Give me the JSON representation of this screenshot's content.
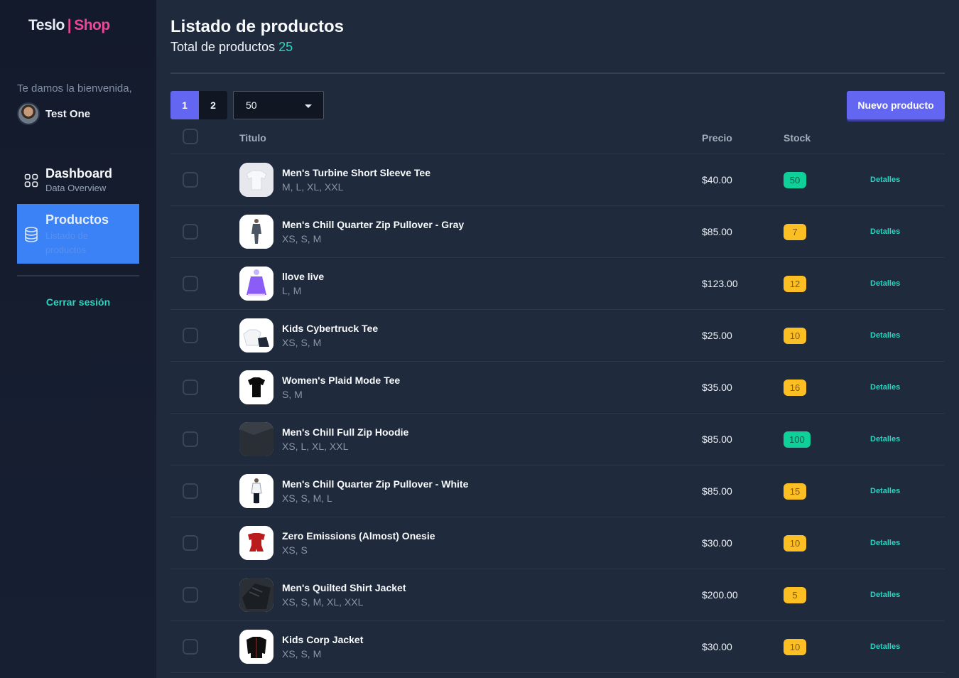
{
  "brand": {
    "name_a": "Teslo",
    "separator": "|",
    "name_b": "Shop"
  },
  "sidebar": {
    "welcome": "Te damos la bienvenida,",
    "user_name": "Test One",
    "items": [
      {
        "title": "Dashboard",
        "subtitle": "Data Overview",
        "icon": "grid-icon"
      },
      {
        "title": "Productos",
        "subtitle": "Listado de productos",
        "icon": "database-icon",
        "active": true
      }
    ],
    "logout": "Cerrar sesión"
  },
  "header": {
    "title": "Listado de productos",
    "subtitle_label": "Total de productos",
    "total": "25"
  },
  "toolbar": {
    "pages": [
      "1",
      "2"
    ],
    "current_page": "1",
    "page_size": "50",
    "new_button": "Nuevo producto"
  },
  "table": {
    "columns": {
      "title": "Titulo",
      "price": "Precio",
      "stock": "Stock"
    },
    "action_label": "Detalles",
    "rows": [
      {
        "name": "Men's Turbine Short Sleeve Tee",
        "sizes": "M, L, XL, XXL",
        "price": "$40.00",
        "stock": "50",
        "status": "ok"
      },
      {
        "name": "Men's Chill Quarter Zip Pullover - Gray",
        "sizes": "XS, S, M",
        "price": "$85.00",
        "stock": "7",
        "status": "low"
      },
      {
        "name": "llove live",
        "sizes": "L, M",
        "price": "$123.00",
        "stock": "12",
        "status": "low"
      },
      {
        "name": "Kids Cybertruck Tee",
        "sizes": "XS, S, M",
        "price": "$25.00",
        "stock": "10",
        "status": "low"
      },
      {
        "name": "Women's Plaid Mode Tee",
        "sizes": "S, M",
        "price": "$35.00",
        "stock": "16",
        "status": "low"
      },
      {
        "name": "Men's Chill Full Zip Hoodie",
        "sizes": "XS, L, XL, XXL",
        "price": "$85.00",
        "stock": "100",
        "status": "ok"
      },
      {
        "name": "Men's Chill Quarter Zip Pullover - White",
        "sizes": "XS, S, M, L",
        "price": "$85.00",
        "stock": "15",
        "status": "low"
      },
      {
        "name": "Zero Emissions (Almost) Onesie",
        "sizes": "XS, S",
        "price": "$30.00",
        "stock": "10",
        "status": "low"
      },
      {
        "name": "Men's Quilted Shirt Jacket",
        "sizes": "XS, S, M, XL, XXL",
        "price": "$200.00",
        "stock": "5",
        "status": "low"
      },
      {
        "name": "Kids Corp Jacket",
        "sizes": "XS, S, M",
        "price": "$30.00",
        "stock": "10",
        "status": "low"
      }
    ]
  },
  "colors": {
    "accent": "#6366f1",
    "active_nav": "#3b82f6",
    "teal": "#2dd4bf",
    "pink": "#ec4899",
    "stock_ok": "#10d09a",
    "stock_low": "#fbbf24"
  }
}
